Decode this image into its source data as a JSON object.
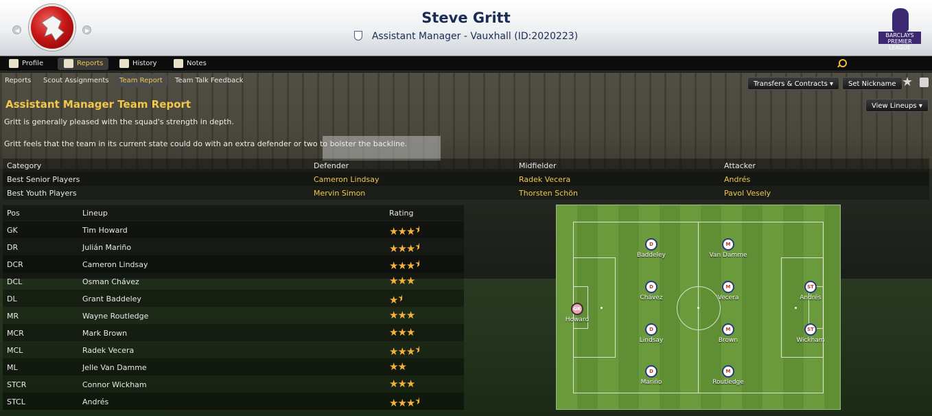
{
  "header": {
    "name": "Steve Gritt",
    "subtitle": "Assistant Manager - Vauxhall (ID:2020223)",
    "league_logo_text": "BARCLAYS PREMIER LEAGUE"
  },
  "tabs": [
    {
      "label": "Profile",
      "icon": "profile-icon"
    },
    {
      "label": "Reports",
      "icon": "reports-icon"
    },
    {
      "label": "History",
      "icon": "history-icon"
    },
    {
      "label": "Notes",
      "icon": "notes-icon"
    }
  ],
  "subtabs": [
    {
      "label": "Reports"
    },
    {
      "label": "Scout Assignments"
    },
    {
      "label": "Team Report"
    },
    {
      "label": "Team Talk Feedback"
    }
  ],
  "actions": {
    "transfers": "Transfers & Contracts ▾",
    "nickname": "Set Nickname",
    "view_lineups": "View Lineups ▾"
  },
  "report": {
    "title": "Assistant Manager Team Report",
    "line1": "Gritt is generally pleased with the squad's strength in depth.",
    "line2": "Gritt feels that the team in its current state could do with an extra defender or two to bolster the backline."
  },
  "categories": {
    "headers": [
      "Category",
      "Defender",
      "Midfielder",
      "Attacker"
    ],
    "rows": [
      {
        "category": "Best Senior Players",
        "defender": "Cameron Lindsay",
        "midfielder": "Radek Vecera",
        "attacker": "Andrés"
      },
      {
        "category": "Best Youth Players",
        "defender": "Mervin Simon",
        "midfielder": "Thorsten Schön",
        "attacker": "Pavol Vesely"
      }
    ]
  },
  "lineup": {
    "headers": [
      "Pos",
      "Lineup",
      "Rating"
    ],
    "rows": [
      {
        "pos": "GK",
        "name": "Tim Howard",
        "rating": 3.5
      },
      {
        "pos": "DR",
        "name": "Julián Mariño",
        "rating": 3.5
      },
      {
        "pos": "DCR",
        "name": "Cameron Lindsay",
        "rating": 3.5
      },
      {
        "pos": "DCL",
        "name": "Osman Chávez",
        "rating": 3
      },
      {
        "pos": "DL",
        "name": "Grant Baddeley",
        "rating": 1.5
      },
      {
        "pos": "MR",
        "name": "Wayne Routledge",
        "rating": 3
      },
      {
        "pos": "MCR",
        "name": "Mark Brown",
        "rating": 3
      },
      {
        "pos": "MCL",
        "name": "Radek Vecera",
        "rating": 3.5
      },
      {
        "pos": "ML",
        "name": "Jelle Van Damme",
        "rating": 2
      },
      {
        "pos": "STCR",
        "name": "Connor Wickham",
        "rating": 3
      },
      {
        "pos": "STCL",
        "name": "Andrés",
        "rating": 3.5
      }
    ]
  },
  "pitch": {
    "players": [
      {
        "role": "GK",
        "name": "Howard"
      },
      {
        "role": "D",
        "name": "Baddeley"
      },
      {
        "role": "D",
        "name": "Chávez"
      },
      {
        "role": "D",
        "name": "Lindsay"
      },
      {
        "role": "D",
        "name": "Mariño"
      },
      {
        "role": "M",
        "name": "Van Damme"
      },
      {
        "role": "M",
        "name": "Vecera"
      },
      {
        "role": "M",
        "name": "Brown"
      },
      {
        "role": "M",
        "name": "Routledge"
      },
      {
        "role": "ST",
        "name": "Andrés"
      },
      {
        "role": "ST",
        "name": "Wickham"
      }
    ]
  },
  "colors": {
    "accent": "#f2c84a",
    "title": "#1a2c56",
    "star": "#f6b13a"
  }
}
